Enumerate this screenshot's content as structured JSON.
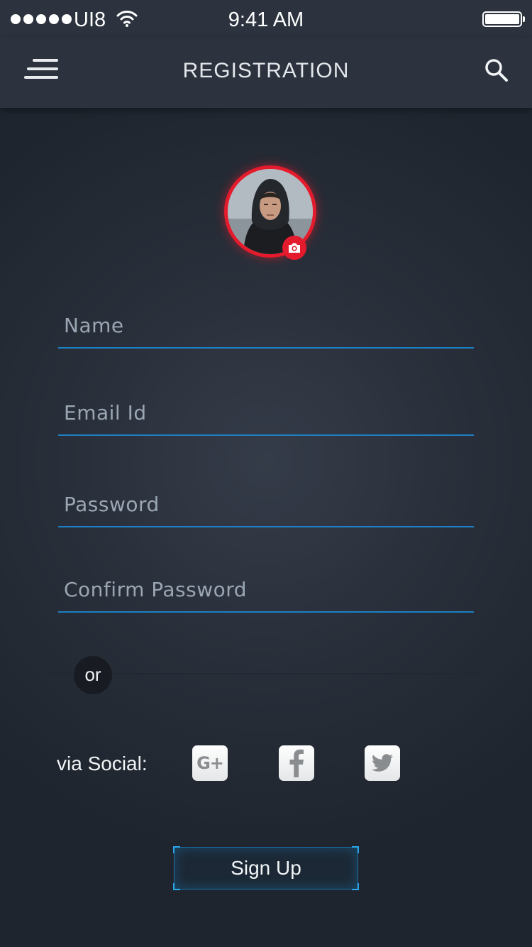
{
  "status_bar": {
    "carrier": "UI8",
    "time": "9:41 AM"
  },
  "nav": {
    "title": "REGISTRATION"
  },
  "form": {
    "name_placeholder": "Name",
    "email_placeholder": "Email Id",
    "password_placeholder": "Password",
    "confirm_password_placeholder": "Confirm Password"
  },
  "divider": {
    "or_label": "or"
  },
  "social": {
    "label": "via Social:",
    "google_label": "G+"
  },
  "actions": {
    "signup_label": "Sign Up"
  },
  "colors": {
    "accent_blue": "#1d7fc4",
    "accent_red": "#e41b2c",
    "background": "#2a303b"
  }
}
